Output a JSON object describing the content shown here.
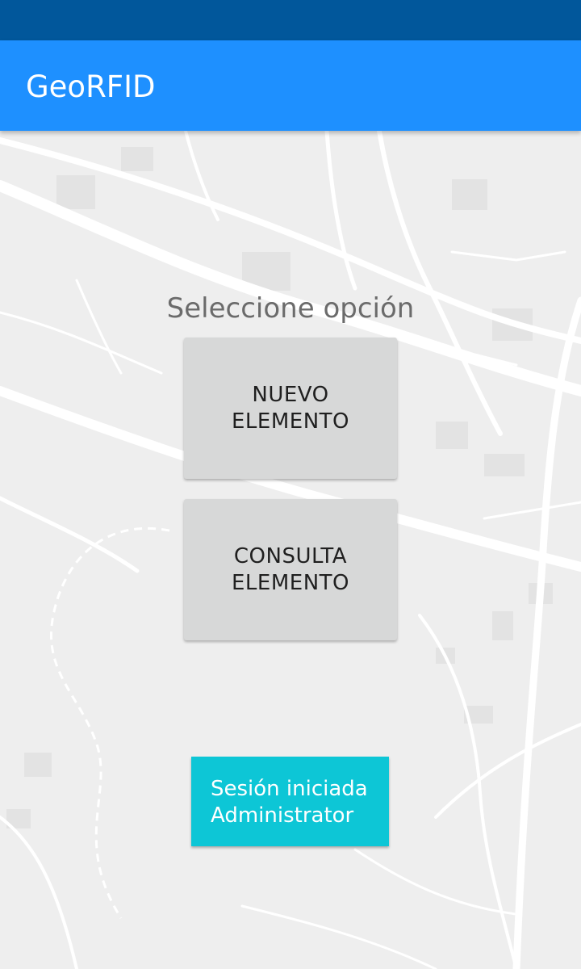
{
  "app": {
    "title": "GeoRFID"
  },
  "main": {
    "prompt": "Seleccione opción",
    "buttons": [
      {
        "line1": "NUEVO",
        "line2": "ELEMENTO"
      },
      {
        "line1": "CONSULTA",
        "line2": "ELEMENTO"
      }
    ],
    "session": {
      "line1": "Sesión iniciada",
      "line2": "Administrator"
    }
  },
  "colors": {
    "status_bar": "#01579b",
    "app_bar": "#1e90ff",
    "button_bg": "#d7d8d8",
    "session_bg": "#0dc6d6",
    "map_bg": "#eeeeee"
  }
}
